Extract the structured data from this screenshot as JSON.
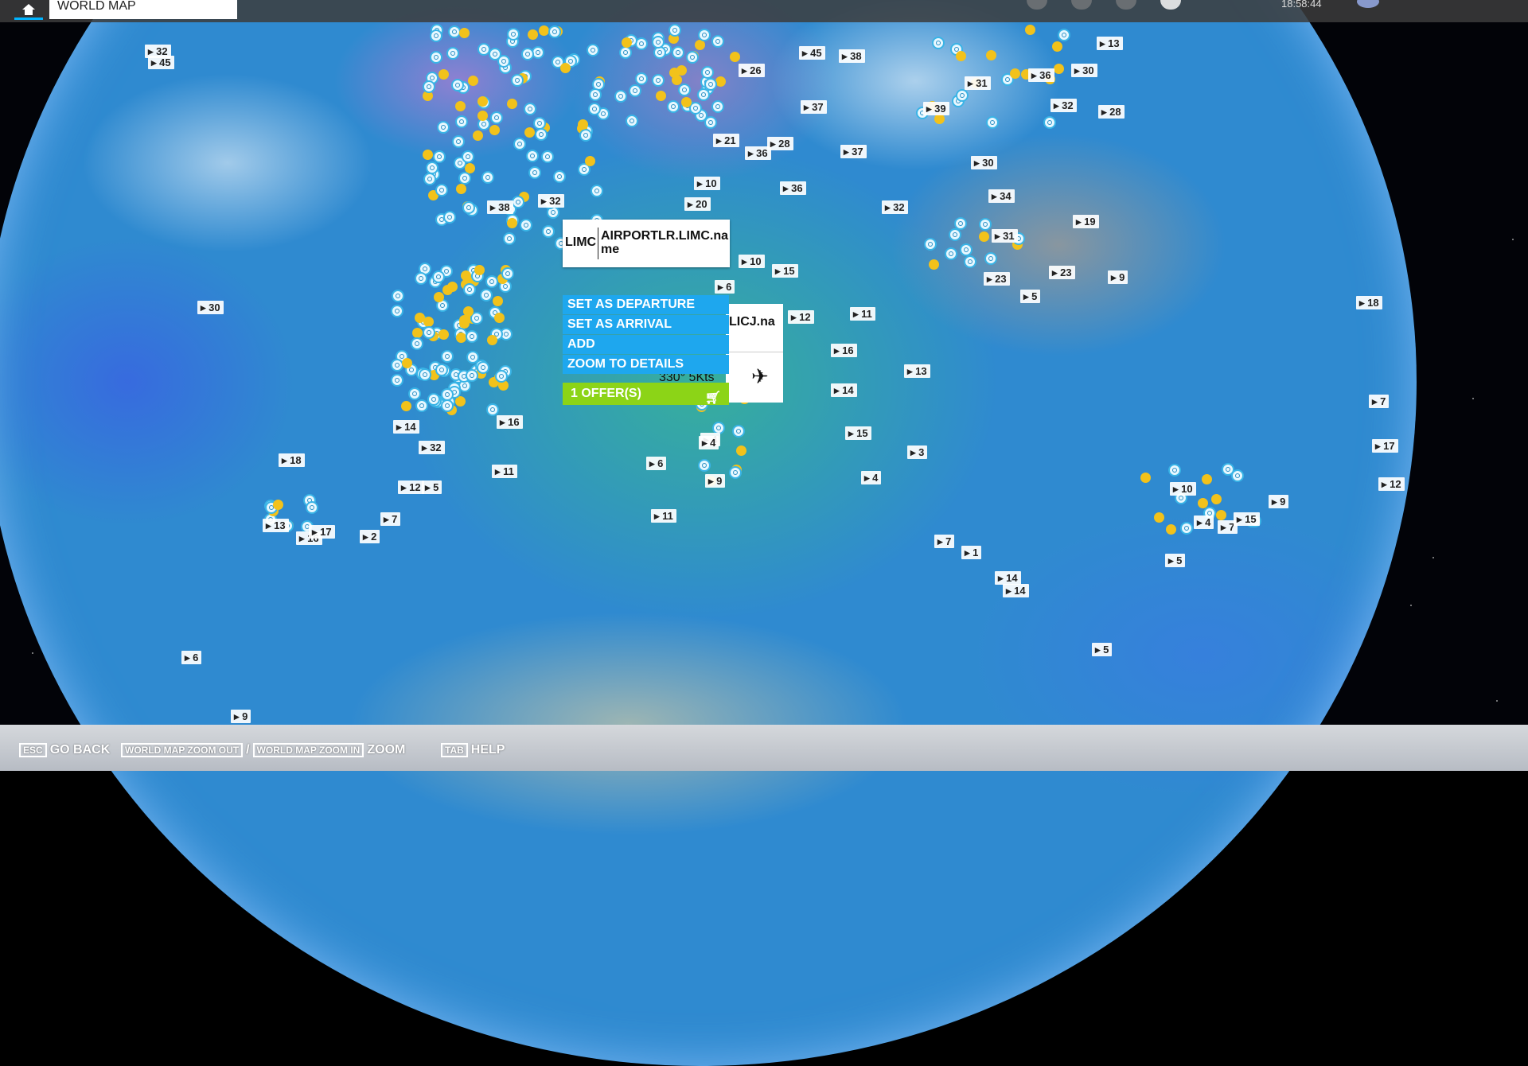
{
  "header": {
    "title": "WORLD MAP",
    "time": "18:58:44"
  },
  "tooltip": {
    "code": "LIMC",
    "name": "AIRPORTLR.LIMC.name"
  },
  "card2": {
    "name": "LICJ.na",
    "wind": "330° 5Kts"
  },
  "context_menu": {
    "items": [
      "SET AS DEPARTURE",
      "SET AS ARRIVAL",
      "ADD",
      "ZOOM TO DETAILS"
    ],
    "offers": "1 OFFER(S)"
  },
  "footer": {
    "back_key": "ESC",
    "back_label": "GO BACK",
    "zoom_out_key": "WORLD MAP ZOOM OUT",
    "separator": "/",
    "zoom_in_key": "WORLD MAP ZOOM IN",
    "zoom_label": "ZOOM",
    "help_key": "TAB",
    "help_label": "HELP"
  },
  "wind_labels": [
    "45",
    "32",
    "26",
    "45",
    "38",
    "13",
    "31",
    "36",
    "30",
    "39",
    "32",
    "28",
    "37",
    "21",
    "36",
    "28",
    "37",
    "36",
    "30",
    "34",
    "32",
    "38",
    "32",
    "20",
    "10",
    "19",
    "31",
    "23",
    "23",
    "9",
    "5",
    "10",
    "15",
    "6",
    "12",
    "11",
    "16",
    "13",
    "14",
    "15",
    "4",
    "3",
    "4",
    "30",
    "18",
    "18",
    "32",
    "14",
    "16",
    "11",
    "12",
    "5",
    "7",
    "2",
    "13",
    "16",
    "17",
    "6",
    "4",
    "9",
    "11",
    "7",
    "1",
    "14",
    "14",
    "10",
    "4",
    "7",
    "5",
    "9",
    "5",
    "6",
    "9",
    "15",
    "7",
    "17",
    "12"
  ]
}
